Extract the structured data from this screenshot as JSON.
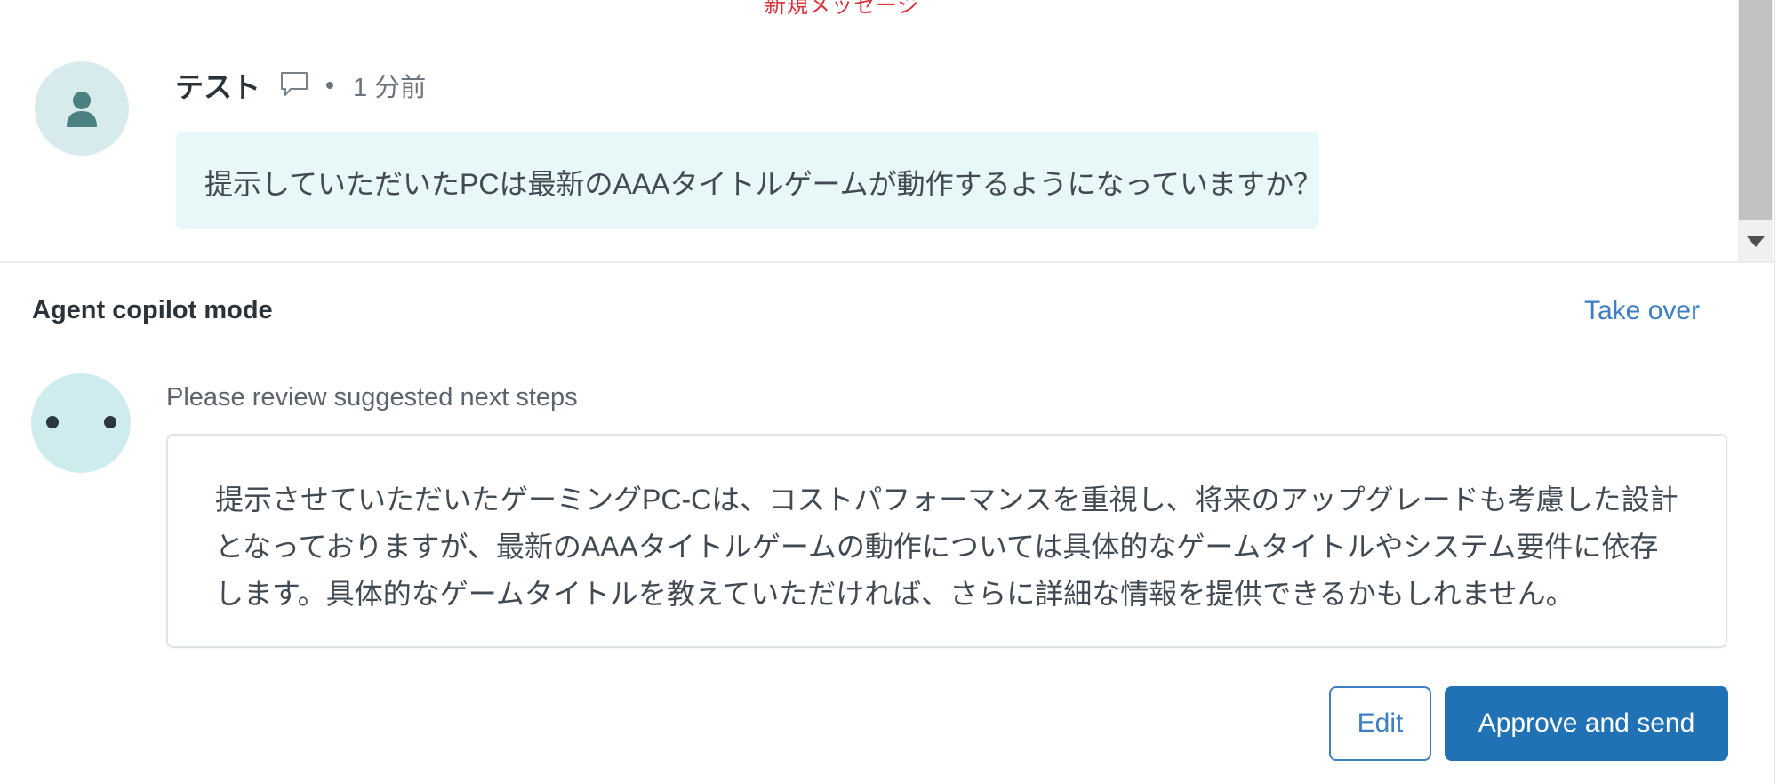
{
  "conversation": {
    "new_messages_divider": "新規メッセージ",
    "message": {
      "author": "テスト",
      "channel_icon": "comment-icon",
      "time": "1 分前",
      "text": "提示していただいたPCは最新のAAAタイトルゲームが動作するようになっていますか？"
    }
  },
  "copilot": {
    "title": "Agent copilot mode",
    "take_over_label": "Take over",
    "review_label": "Please review suggested next steps",
    "suggestion_text": "提示させていただいたゲーミングPC-Cは、コストパフォーマンスを重視し、将来のアップグレードも考慮した設計となっておりますが、最新のAAAタイトルゲームの動作については具体的なゲームタイトルやシステム要件に依存します。具体的なゲームタイトルを教えていただければ、さらに詳細な情報を提供できるかもしれません。",
    "edit_label": "Edit",
    "approve_label": "Approve and send"
  },
  "colors": {
    "accent": "#2171b5",
    "link": "#3d7fc1",
    "new_message_red": "#d9363e",
    "bubble_bg": "#e8f7f7",
    "avatar_bg": "#d8ebec"
  }
}
